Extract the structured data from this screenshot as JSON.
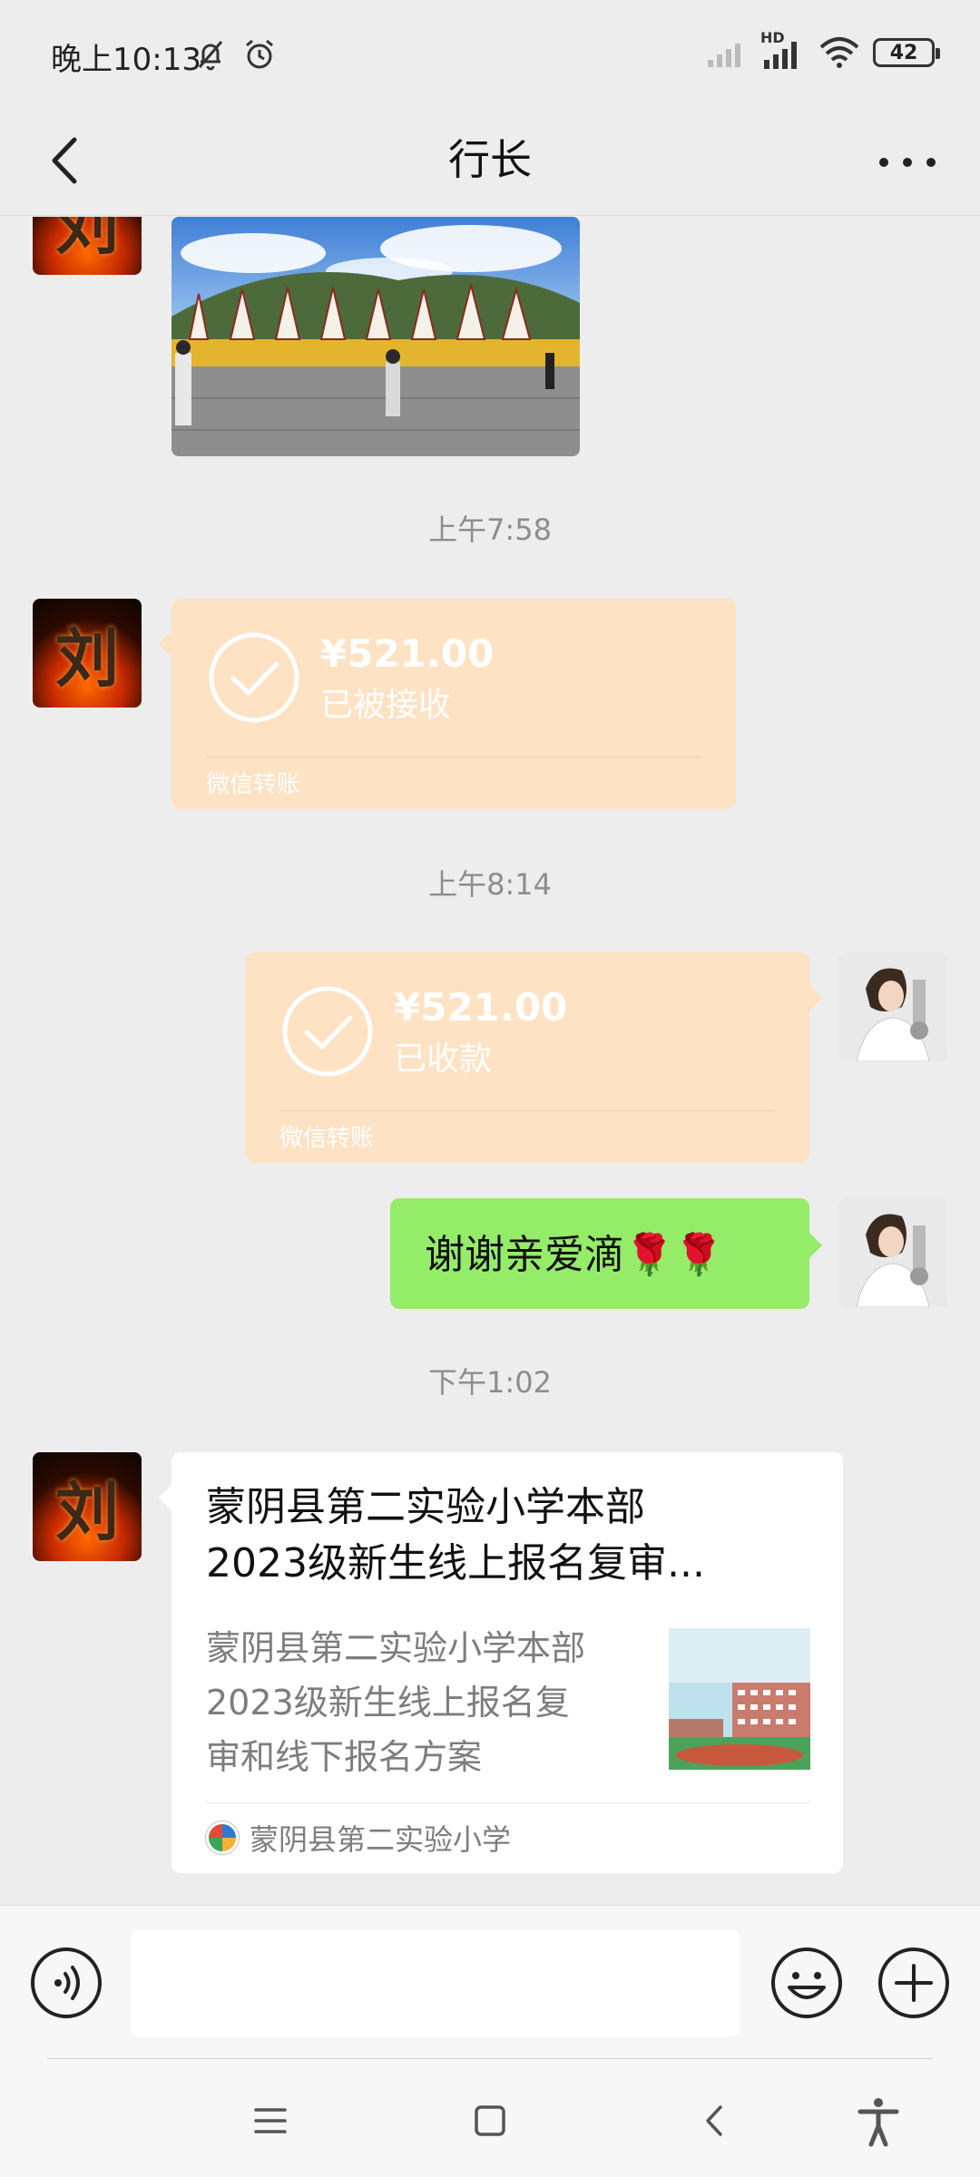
{
  "status_bar": {
    "time": "晚上10:13",
    "battery": "42",
    "network_label": "HD"
  },
  "header": {
    "title": "行长"
  },
  "messages": {
    "photo": {
      "alt": "景区佛塔照片"
    },
    "timestamp_1": "上午7:58",
    "transfer_received_by_them": {
      "amount": "¥521.00",
      "state": "已被接收",
      "brand": "微信转账"
    },
    "timestamp_2": "上午8:14",
    "transfer_collected": {
      "amount": "¥521.00",
      "state": "已收款",
      "brand": "微信转账"
    },
    "text_reply": {
      "text": "谢谢亲爱滴🌹🌹"
    },
    "timestamp_3": "下午1:02",
    "link_card": {
      "title_line1": "蒙阴县第二实验小学本部",
      "title_line2": "2023级新生线上报名复审...",
      "desc_line1": "蒙阴县第二实验小学本部",
      "desc_line2": "2023级新生线上报名复",
      "desc_line3": "审和线下报名方案",
      "source": "蒙阴县第二实验小学"
    }
  },
  "avatars": {
    "left_glyph": "刘"
  },
  "input_bar": {
    "placeholder": ""
  },
  "colors": {
    "background": "#ededed",
    "transfer_bubble": "#fde2c4",
    "sent_bubble": "#95ec69",
    "card": "#ffffff"
  },
  "icons": {
    "voice": "voice-icon",
    "emoji": "emoji-icon",
    "plus": "plus-icon",
    "back": "back-arrow-icon",
    "more": "more-icon"
  }
}
